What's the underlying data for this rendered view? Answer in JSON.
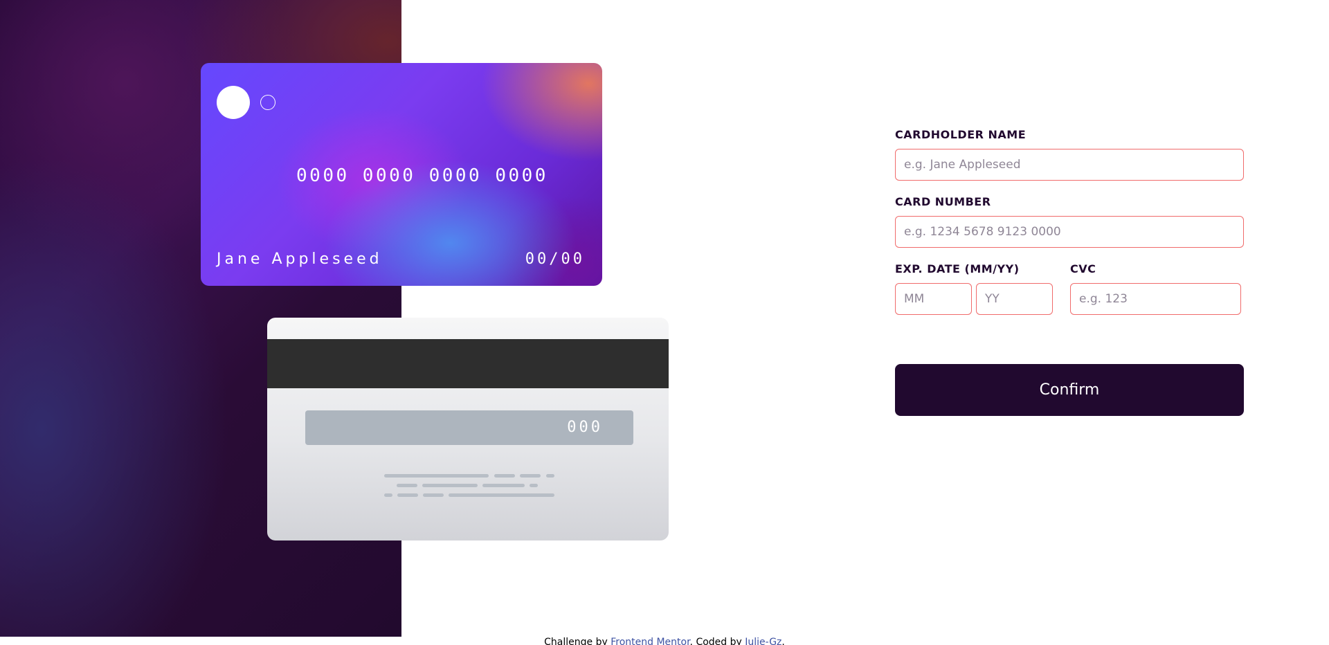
{
  "card_front": {
    "number": "0000 0000 0000 0000",
    "name": "Jane Appleseed",
    "expiry": "00/00"
  },
  "card_back": {
    "cvc": "000"
  },
  "form": {
    "cardholder_label": "CARDHOLDER NAME",
    "cardholder_placeholder": "e.g. Jane Appleseed",
    "number_label": "CARD NUMBER",
    "number_placeholder": "e.g. 1234 5678 9123 0000",
    "exp_label": "EXP. DATE (MM/YY)",
    "month_placeholder": "MM",
    "year_placeholder": "YY",
    "cvc_label": "CVC",
    "cvc_placeholder": "e.g. 123",
    "confirm_label": "Confirm"
  },
  "footer": {
    "prefix": "Challenge by ",
    "link1": "Frontend Mentor",
    "middle": ". Coded by ",
    "link2": "Julie-Gz",
    "suffix": "."
  },
  "colors": {
    "dark": "#21092f",
    "error_border": "#f06a6a",
    "link": "#3e52a3"
  }
}
